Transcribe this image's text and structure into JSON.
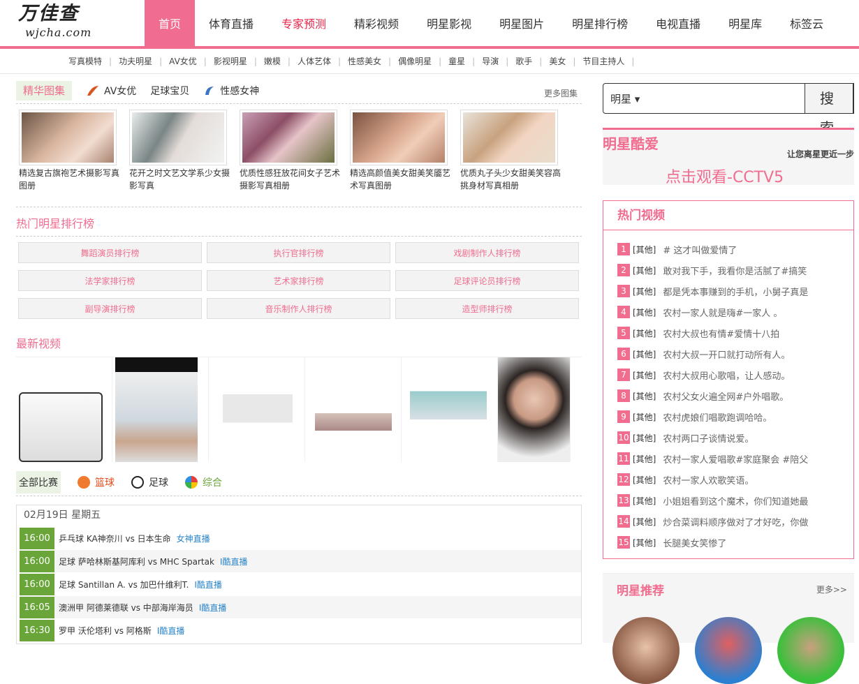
{
  "logo": {
    "cn": "万佳查",
    "en": "wjcha.com"
  },
  "nav": [
    "首页",
    "体育直播",
    "专家预测",
    "精彩视频",
    "明星影视",
    "明星图片",
    "明星排行榜",
    "电视直播",
    "明星库",
    "标签云"
  ],
  "subnav": [
    "写真模特",
    "功夫明星",
    "AV女优",
    "影视明星",
    "嫩模",
    "人体艺体",
    "性感美女",
    "偶像明星",
    "童星",
    "导演",
    "歌手",
    "美女",
    "节目主持人"
  ],
  "gallery": {
    "tab_active": "精华图集",
    "tabs": [
      "AV女优",
      "足球宝贝",
      "性感女神"
    ],
    "more": "更多图集",
    "items": [
      "精选复古旗袍艺术摄影写真图册",
      "花开之时文艺文学系少女摄影写真",
      "优质性感狂放花间女子艺术摄影写真相册",
      "精选高颜值美女甜美笑靥艺术写真图册",
      "优质丸子头少女甜美笑容高挑身材写真相册"
    ]
  },
  "rank": {
    "title": "热门明星排行榜",
    "buttons": [
      "舞蹈演员排行榜",
      "执行官排行榜",
      "戏剧制作人排行榜",
      "法学家排行榜",
      "艺术家排行榜",
      "足球评论员排行榜",
      "副导演排行榜",
      "音乐制作人排行榜",
      "造型师排行榜"
    ]
  },
  "videos": {
    "title": "最新视频"
  },
  "sports": {
    "tabs": [
      "全部比赛",
      "篮球",
      "足球",
      "综合"
    ],
    "date": "02月19日 星期五",
    "rows": [
      {
        "time": "16:00",
        "text": "乒乓球   KA神奈川 vs 日本生命",
        "link": "女神直播"
      },
      {
        "time": "16:00",
        "text": "足球   萨哈林斯基阿库利 vs MHC Spartak",
        "link": "I酷直播"
      },
      {
        "time": "16:00",
        "text": "足球   Santillan A. vs 加巴什维利T.",
        "link": "I酷直播"
      },
      {
        "time": "16:05",
        "text": "澳洲甲   阿德莱德联 vs 中部海岸海员",
        "link": "I酷直播"
      },
      {
        "time": "16:30",
        "text": "罗甲   沃伦塔利 vs 阿格斯",
        "link": "I酷直播"
      }
    ]
  },
  "search": {
    "select": "明星 ▾",
    "button": "搜索"
  },
  "ad": {
    "title": "明星酷爱",
    "slogan": "让您离星更近一步",
    "link": "点击观看-CCTV5"
  },
  "hot": {
    "title": "热门视频",
    "items": [
      {
        "n": "1",
        "cat": "[其他]",
        "t": "# 这才叫做爱情了"
      },
      {
        "n": "2",
        "cat": "[其他]",
        "t": "敢对我下手，我看你是活腻了#搞笑"
      },
      {
        "n": "3",
        "cat": "[其他]",
        "t": "都是凭本事赚到的手机，小舅子真是"
      },
      {
        "n": "4",
        "cat": "[其他]",
        "t": "农村一家人就是嗨#一家人 。"
      },
      {
        "n": "5",
        "cat": "[其他]",
        "t": "农村大叔也有情#爱情十八拍"
      },
      {
        "n": "6",
        "cat": "[其他]",
        "t": "农村大叔一开口就打动所有人。"
      },
      {
        "n": "7",
        "cat": "[其他]",
        "t": "农村大叔用心歌唱，让人感动。"
      },
      {
        "n": "8",
        "cat": "[其他]",
        "t": "农村父女火遍全网#户外唱歌。"
      },
      {
        "n": "9",
        "cat": "[其他]",
        "t": "农村虎娘们唱歌跑调哈哈。"
      },
      {
        "n": "10",
        "cat": "[其他]",
        "t": "农村两口子谈情说爱。"
      },
      {
        "n": "11",
        "cat": "[其他]",
        "t": "农村一家人爱唱歌#家庭聚会 #陪父"
      },
      {
        "n": "12",
        "cat": "[其他]",
        "t": "农村一家人欢歌笑语。"
      },
      {
        "n": "13",
        "cat": "[其他]",
        "t": "小姐姐看到这个魔术，你们知道她最"
      },
      {
        "n": "14",
        "cat": "[其他]",
        "t": "炒合菜调料顺序做对了才好吃，你做"
      },
      {
        "n": "15",
        "cat": "[其他]",
        "t": "长腿美女笑惨了"
      }
    ]
  },
  "rec": {
    "title": "明星推荐",
    "more": "更多>>"
  },
  "colors": {
    "accent": "#f06d8f",
    "green": "#6aa53a",
    "link": "#2a85c9"
  }
}
